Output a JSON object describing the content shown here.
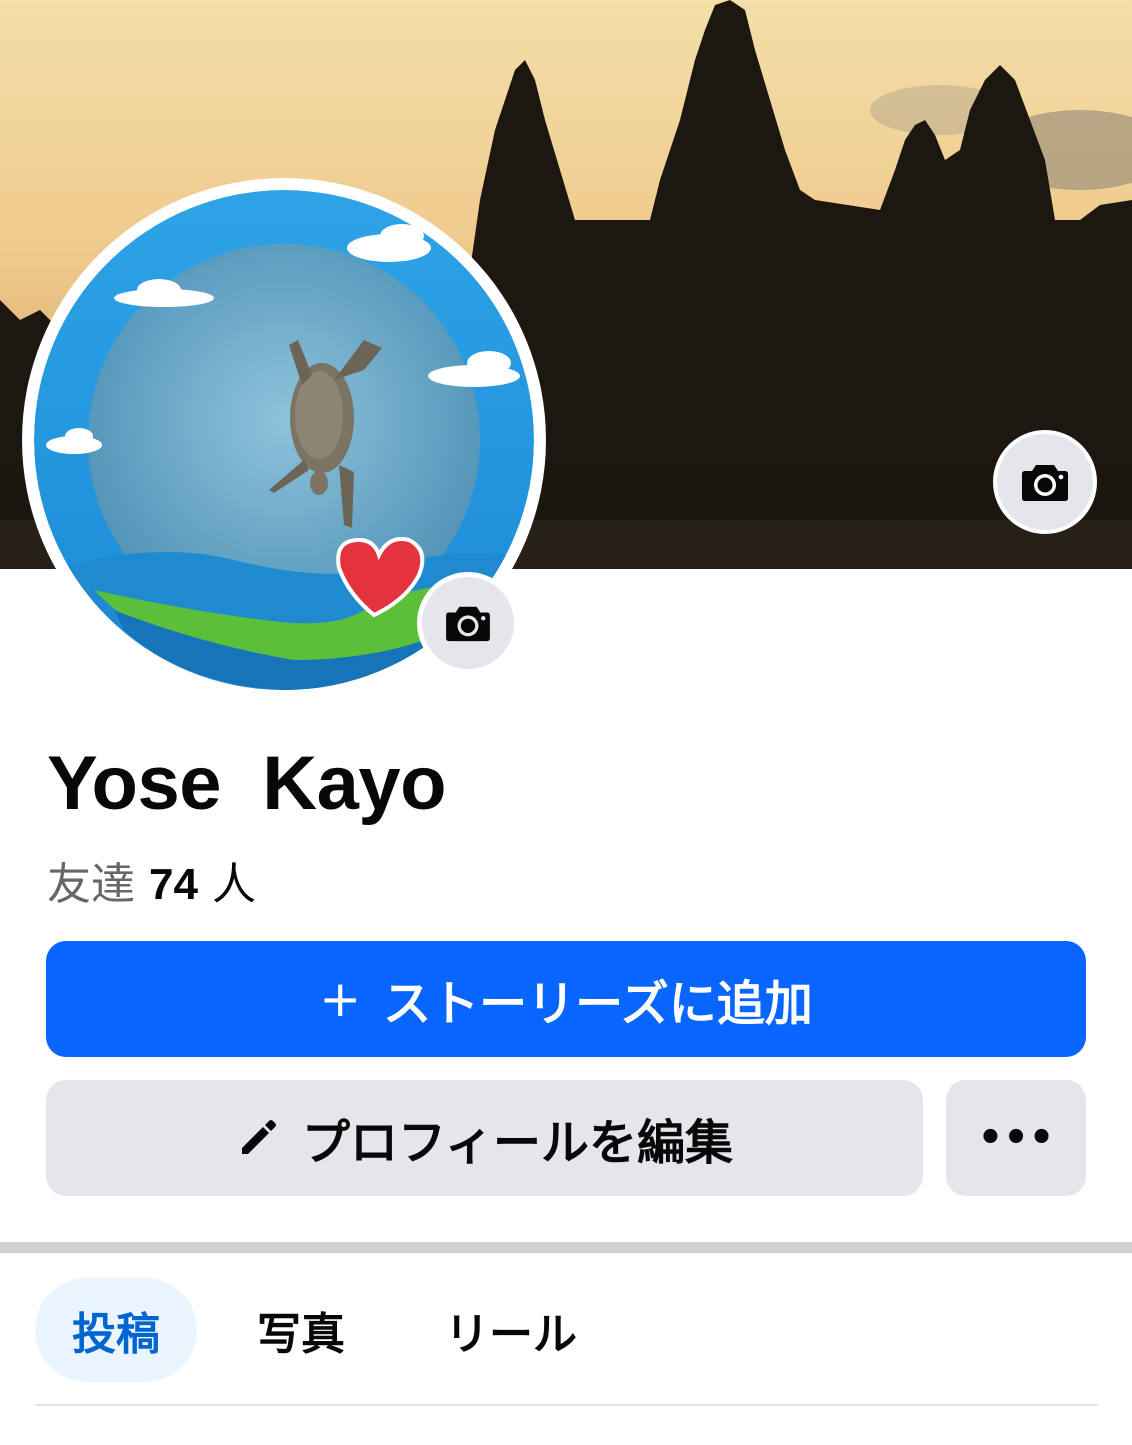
{
  "profile": {
    "name": "Yose  Kayo",
    "friends_label": "友達",
    "friends_count": "74",
    "friends_unit": "人"
  },
  "actions": {
    "add_story_plus": "+",
    "add_story_label": "ストーリーズに追加",
    "edit_profile_label": "プロフィールを編集",
    "more_label": "•••"
  },
  "tabs": [
    {
      "label": "投稿",
      "active": true
    },
    {
      "label": "写真",
      "active": false
    },
    {
      "label": "リール",
      "active": false
    }
  ],
  "icons": {
    "cover_camera": "camera-icon",
    "avatar_camera": "camera-icon",
    "edit": "pencil-icon"
  },
  "colors": {
    "primary": "#0866ff",
    "secondary_button": "#e4e6eb",
    "active_tab_bg": "#ebf5ff",
    "active_tab_text": "#0064d1"
  }
}
